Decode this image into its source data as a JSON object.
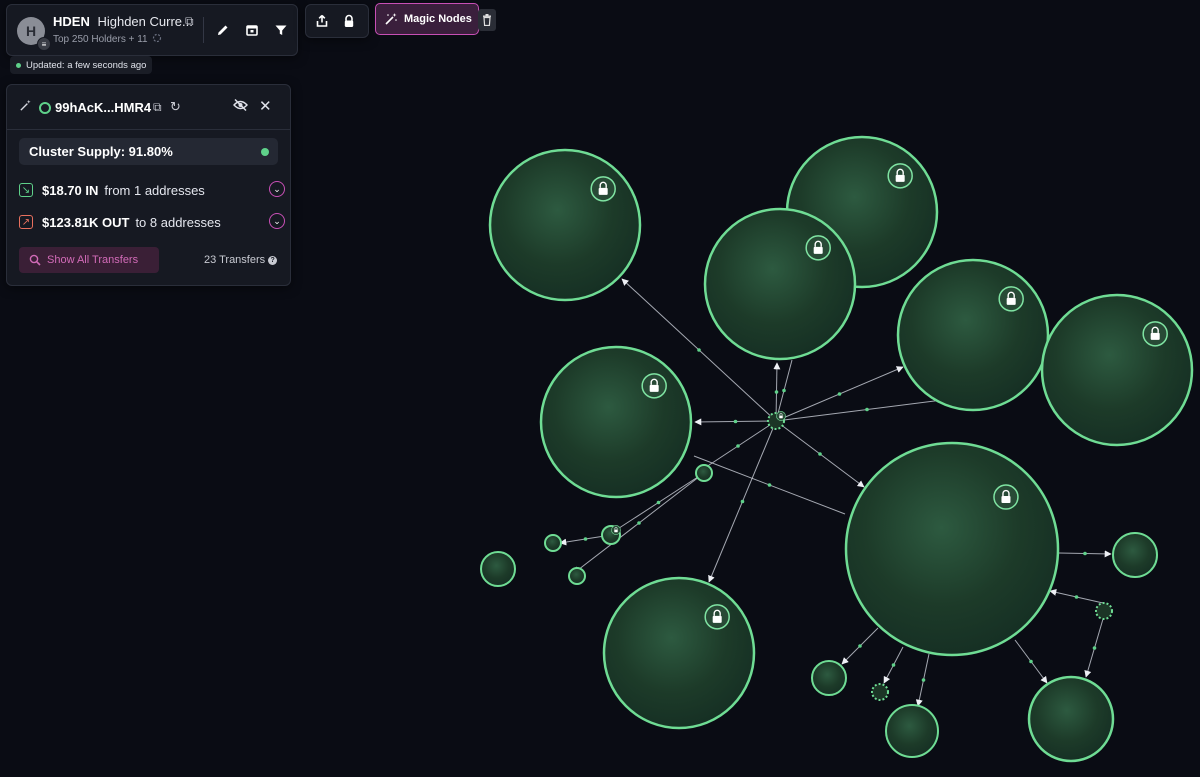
{
  "token": {
    "avatar_letter": "H",
    "symbol": "HDEN",
    "name": "Highden Curre...",
    "subtitle": "Top 250 Holders + 11"
  },
  "status": {
    "updated": "Updated: a few seconds ago"
  },
  "toolbar": {
    "magic_label": "Magic Nodes"
  },
  "cluster": {
    "address": "99hAcK...HMR4",
    "supply_label": "Cluster Supply: 91.80%",
    "in_amount": "$18.70 IN",
    "in_rest": "from 1 addresses",
    "out_amount": "$123.81K OUT",
    "out_rest": "to 8 addresses",
    "show_all_label": "Show All Transfers",
    "transfers_count": "23 Transfers"
  },
  "graph": {
    "icons": [
      "lock-icon"
    ],
    "colors": {
      "node_fill": "#1f3d2c",
      "node_stroke": "#6fdc94",
      "edge": "#d8dce6"
    }
  }
}
